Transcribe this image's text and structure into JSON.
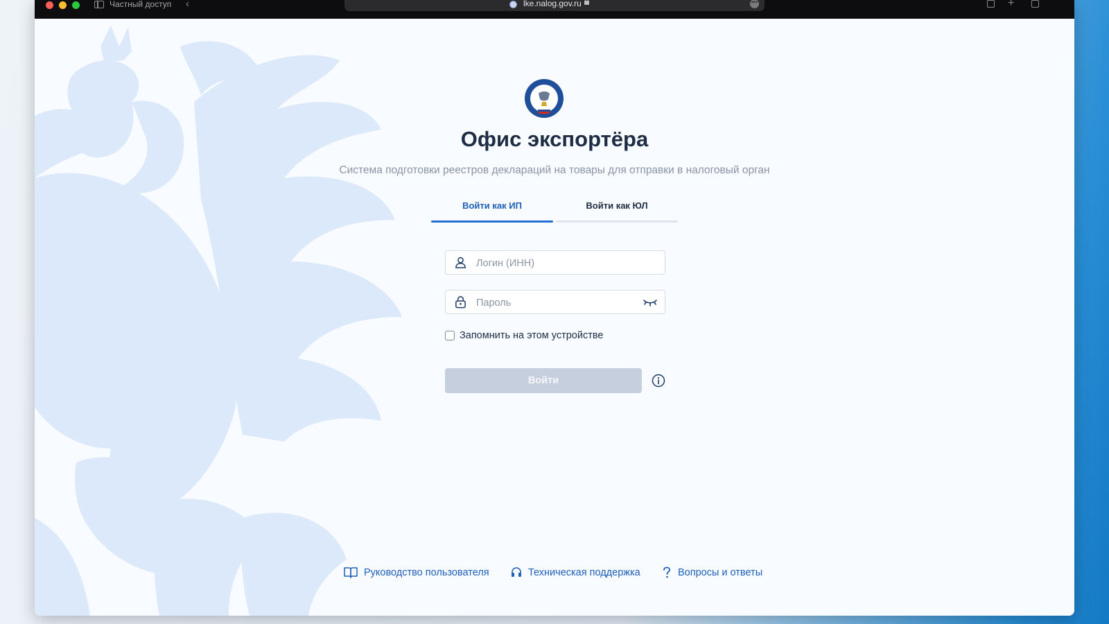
{
  "browser": {
    "private_label": "Частный доступ",
    "url": "lke.nalog.gov.ru"
  },
  "page": {
    "title": "Офис экспортёра",
    "subtitle": "Система подготовки реестров деклараций на товары для отправки в налоговый орган"
  },
  "tabs": [
    {
      "label": "Войти как ИП",
      "active": true
    },
    {
      "label": "Войти как ЮЛ",
      "active": false
    }
  ],
  "form": {
    "login_placeholder": "Логин (ИНН)",
    "login_value": "",
    "password_placeholder": "Пароль",
    "password_value": "",
    "remember_label": "Запомнить на этом устройстве",
    "remember_checked": false,
    "submit_label": "Войти"
  },
  "footer": {
    "guide": "Руководство пользователя",
    "support": "Техническая поддержка",
    "faq": "Вопросы и ответы"
  },
  "colors": {
    "accent": "#1d6fd1",
    "title": "#1f2d44",
    "button_disabled": "#c6cfdd",
    "watermark": "#dce9fb"
  },
  "icons": {
    "login_field": "user-icon",
    "password_field": "lock-icon",
    "password_toggle": "eye-closed-icon",
    "submit_help": "info-icon",
    "guide": "book-icon",
    "support": "headset-icon",
    "faq": "question-icon"
  }
}
